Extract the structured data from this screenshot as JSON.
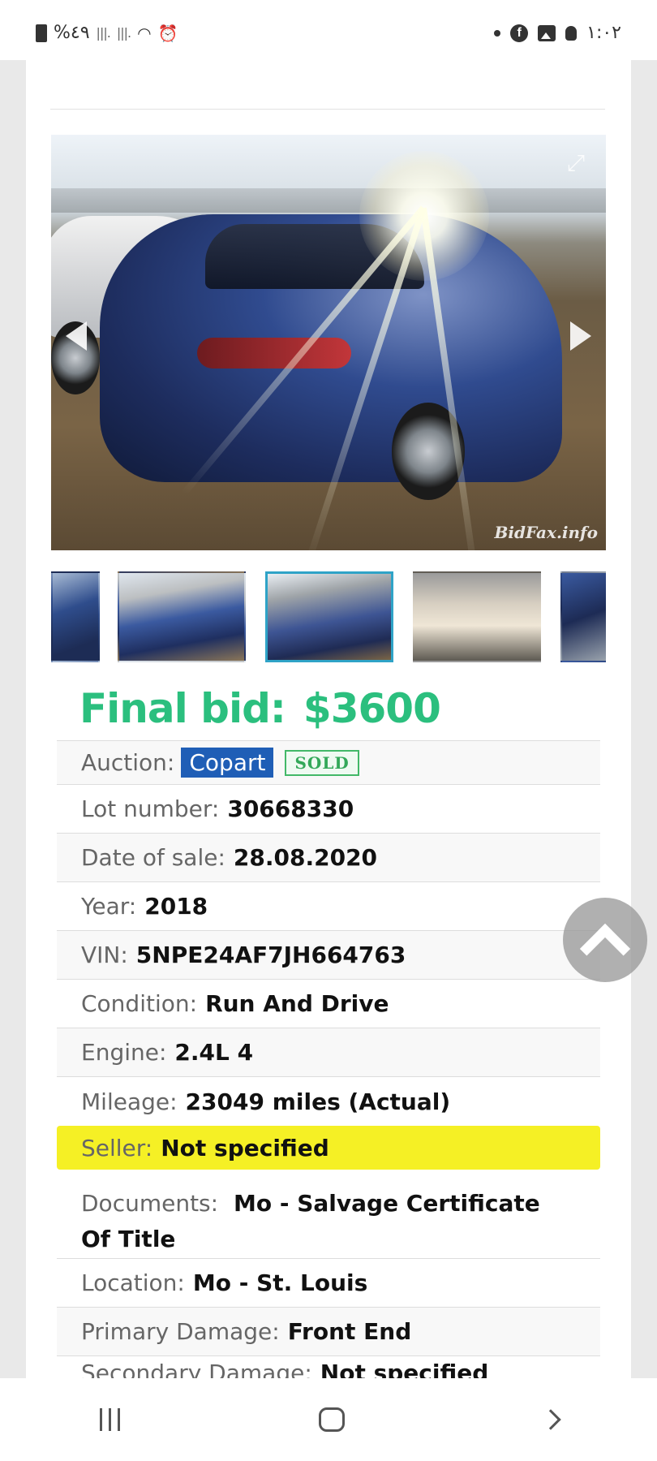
{
  "status_bar": {
    "battery_text": "%٤٩",
    "time": "١:٠٢",
    "icons_left": [
      "battery-icon",
      "signal-icon",
      "signal-icon",
      "wifi-icon",
      "alarm-icon"
    ],
    "icons_right": [
      "dot-icon",
      "facebook-icon",
      "gallery-icon",
      "bulb-icon"
    ]
  },
  "gallery": {
    "watermark": "BidFax.info",
    "selected_thumbnail": 3,
    "thumbnail_count": 5
  },
  "final_bid": {
    "label": "Final bid:",
    "amount": "$3600"
  },
  "details": {
    "auction": {
      "label": "Auction:",
      "value": "Copart",
      "badge": "SOLD"
    },
    "lot_number": {
      "label": "Lot number:",
      "value": "30668330"
    },
    "date_of_sale": {
      "label": "Date of sale:",
      "value": "28.08.2020"
    },
    "year": {
      "label": "Year:",
      "value": "2018"
    },
    "vin": {
      "label": "VIN:",
      "value": "5NPE24AF7JH664763"
    },
    "condition": {
      "label": "Condition:",
      "value": "Run And Drive"
    },
    "engine": {
      "label": "Engine:",
      "value": "2.4L 4"
    },
    "mileage": {
      "label": "Mileage:",
      "value": "23049 miles (Actual)"
    },
    "seller": {
      "label": "Seller:",
      "value": "Not specified"
    },
    "documents": {
      "label": "Documents:",
      "value": "Mo - Salvage Certificate Of Title"
    },
    "location": {
      "label": "Location:",
      "value": "Mo - St. Louis"
    },
    "primary_damage": {
      "label": "Primary Damage:",
      "value": "Front End"
    },
    "secondary_damage": {
      "label": "Secondary Damage:",
      "value": "Not specified"
    }
  },
  "colors": {
    "final_bid": "#2bbf7e",
    "copart_badge": "#1f5eb6",
    "sold_badge": "#42b868",
    "seller_highlight": "#f5f025",
    "thumb_selected_border": "#2fa3c7"
  }
}
